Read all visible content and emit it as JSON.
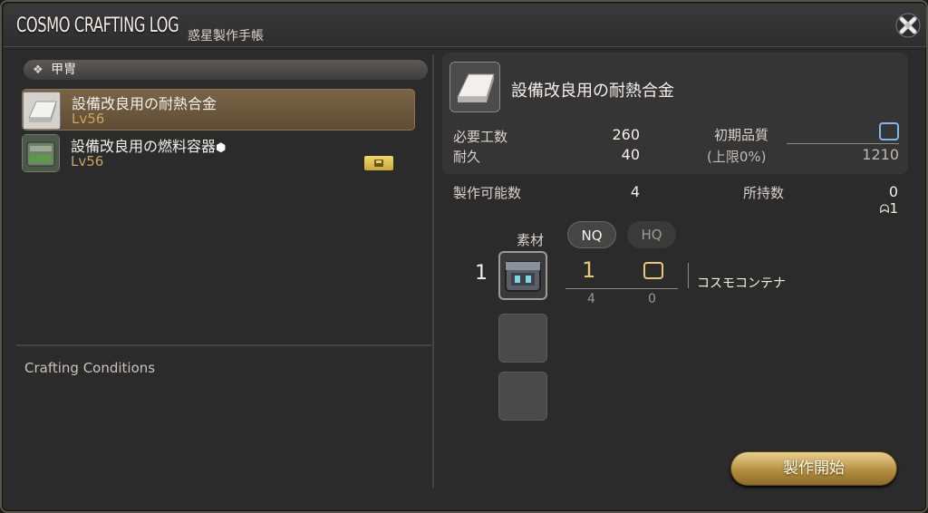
{
  "window": {
    "title": "COSMO CRAFTING LOG",
    "subtitle": "惑星製作手帳"
  },
  "left": {
    "category": "甲冑",
    "recipes": [
      {
        "name": "設備改良用の耐熱合金",
        "level": "Lv56",
        "selected": true,
        "icon": "ingot-icon"
      },
      {
        "name": "設備改良用の燃料容器",
        "level": "Lv56",
        "selected": false,
        "icon": "fuel-container-icon",
        "has_collectable_mark": true
      }
    ],
    "conditions_label": "Crafting Conditions"
  },
  "detail": {
    "item_name": "設備改良用の耐熱合金",
    "icon": "ingot-icon",
    "required_progress_label": "必要工数",
    "required_progress": "260",
    "durability_label": "耐久",
    "durability": "40",
    "initial_quality_label": "初期品質",
    "quality_cap_label": "(上限0%)",
    "quality_max": "1210",
    "craftable_label": "製作可能数",
    "craftable": "4",
    "owned_label": "所持数",
    "owned": "0",
    "owned_hq": "1"
  },
  "materials": {
    "label": "素材",
    "nq_tab": "NQ",
    "hq_tab": "HQ",
    "items": [
      {
        "count": "1",
        "name": "コスモコンテナ",
        "nq_use": "1",
        "nq_have": "4",
        "hq_have": "0",
        "icon": "cosmo-container-icon"
      }
    ]
  },
  "actions": {
    "start_craft": "製作開始"
  },
  "colors": {
    "accent_gold": "#e8c77a",
    "quality_blue": "#7fb6e8",
    "selected_row": "#6c5a40"
  }
}
